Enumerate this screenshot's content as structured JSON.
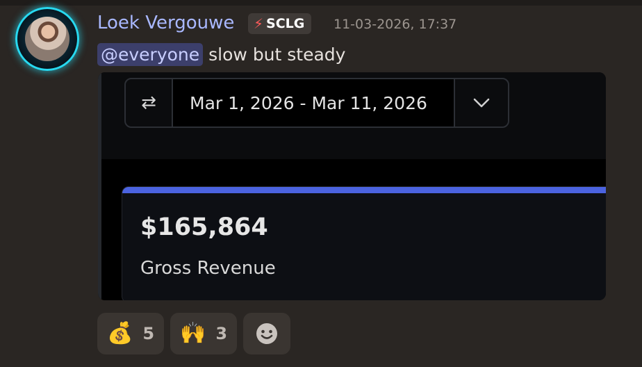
{
  "message": {
    "username": "Loek Vergouwe",
    "tag": {
      "icon": "⚡",
      "label": "SCLG",
      "icon_color": "#ff5a5a"
    },
    "timestamp": "11-03-2026, 17:37",
    "mention": "@everyone",
    "text": "slow but steady",
    "username_color": "#a9b8ff"
  },
  "embed": {
    "swap_icon": "⇄",
    "date_range": "Mar 1, 2026 - Mar 11, 2026",
    "dropdown_icon": "chevron-down-icon",
    "amount": "$165,864",
    "metric_label": "Gross Revenue",
    "accent_color": "#4b63e0"
  },
  "reactions": [
    {
      "emoji": "💰",
      "icon": "money-bag-icon",
      "count": "5"
    },
    {
      "emoji": "🙌",
      "icon": "raising-hands-icon",
      "count": "3"
    }
  ],
  "add_reaction_icon": "smiley-icon"
}
